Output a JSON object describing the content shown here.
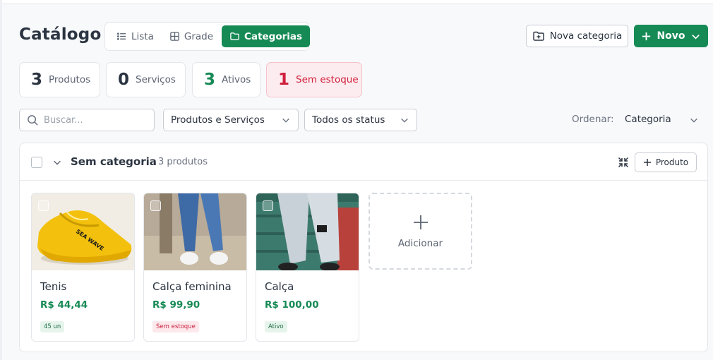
{
  "header": {
    "title": "Catálogo",
    "view_tabs": [
      {
        "label": "Lista",
        "icon": "list-icon",
        "active": false
      },
      {
        "label": "Grade",
        "icon": "grid-icon",
        "active": false
      },
      {
        "label": "Categorias",
        "icon": "folder-icon",
        "active": true
      }
    ],
    "new_category_label": "Nova categoria",
    "new_label": "Novo"
  },
  "stats": [
    {
      "value": "3",
      "label": "Produtos"
    },
    {
      "value": "0",
      "label": "Serviços"
    },
    {
      "value": "3",
      "label": "Ativos"
    },
    {
      "value": "1",
      "label": "Sem estoque"
    }
  ],
  "filters": {
    "search_placeholder": "Buscar...",
    "type_select": "Produtos e Serviços",
    "status_select": "Todos os status",
    "sort_label": "Ordenar:",
    "sort_value": "Categoria"
  },
  "category": {
    "name": "Sem categoria",
    "count": "3 produtos",
    "add_product_label": "Produto",
    "products": [
      {
        "name": "Tenis",
        "price": "R$ 44,44",
        "badge": "45 un",
        "badge_tone": "green"
      },
      {
        "name": "Calça feminina",
        "price": "R$ 99,90",
        "badge": "Sem estoque",
        "badge_tone": "red"
      },
      {
        "name": "Calça",
        "price": "R$ 100,00",
        "badge": "Ativo",
        "badge_tone": "green"
      }
    ],
    "add_card_label": "Adicionar"
  },
  "colors": {
    "accent": "#168a55",
    "danger": "#d01f3c",
    "danger_bg": "#fdecef"
  }
}
